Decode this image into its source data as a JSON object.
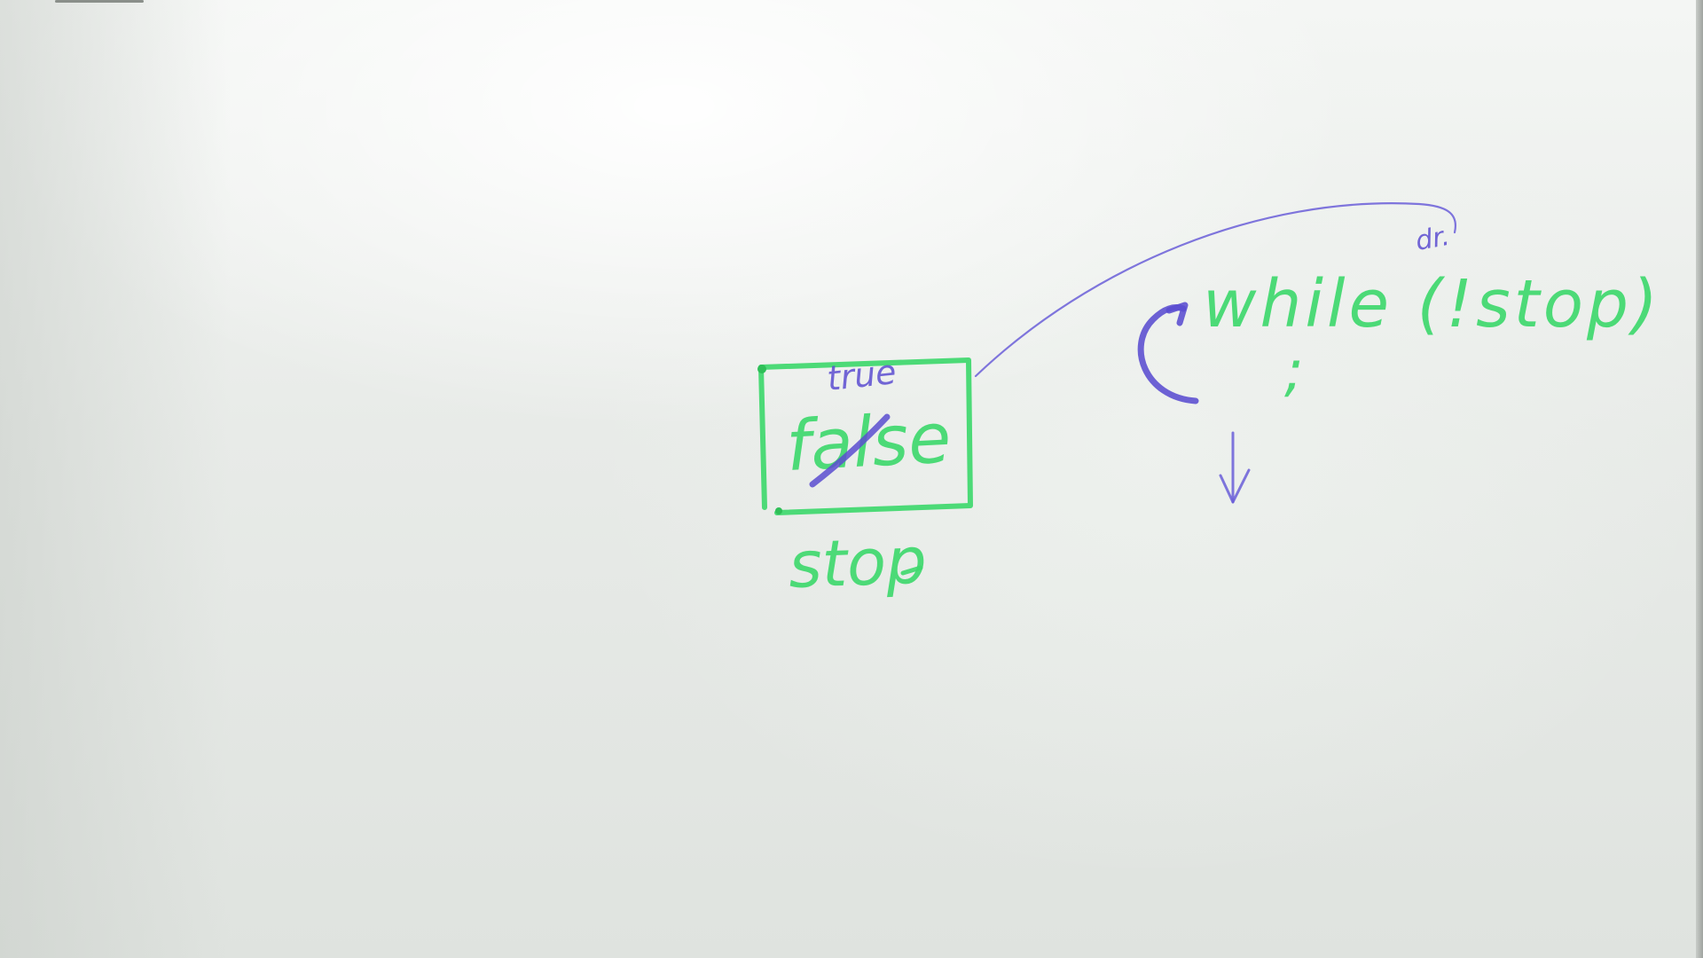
{
  "board": {
    "variable_value_old": "false",
    "variable_value_new": "true",
    "variable_name": "stop",
    "loop_code": "while (!stop)",
    "loop_body": ";",
    "annotation": "dr."
  },
  "colors": {
    "green_marker": "#3ed86c",
    "purple_marker": "#5a4cd0",
    "board": "#e4e7e4"
  }
}
